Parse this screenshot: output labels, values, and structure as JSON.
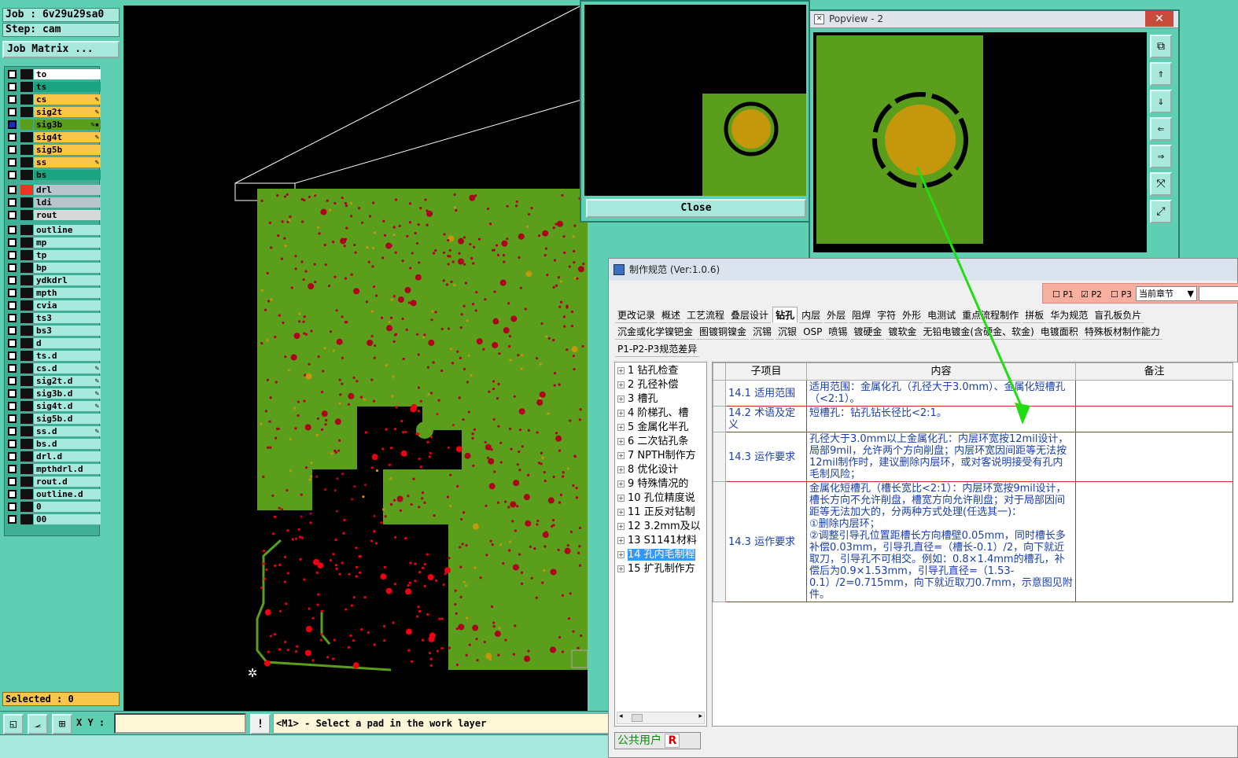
{
  "job_label": "Job : 6v29u29sa0",
  "step_label": "Step: cam",
  "job_matrix": "Job Matrix ...",
  "layers": [
    {
      "name": "to",
      "color": "#ffffff",
      "tag": ""
    },
    {
      "name": "ts",
      "color": "#1aa37f",
      "tag": ""
    },
    {
      "name": "cs",
      "color": "#f7c64a",
      "tag": "✎"
    },
    {
      "name": "sig2t",
      "color": "#f7c64a",
      "tag": "✎"
    },
    {
      "name": "sig3b",
      "color": "#5a9e1c",
      "tag": "✎▪"
    },
    {
      "name": "sig4t",
      "color": "#f7c64a",
      "tag": "✎"
    },
    {
      "name": "sig5b",
      "color": "#f7c64a",
      "tag": ""
    },
    {
      "name": "ss",
      "color": "#f7c64a",
      "tag": "✎"
    },
    {
      "name": "bs",
      "color": "#1aa37f",
      "tag": ""
    },
    {
      "name": "drl",
      "color": "#b8c3cb",
      "tag": ""
    },
    {
      "name": "ldi",
      "color": "#b8c3cb",
      "tag": ""
    },
    {
      "name": "rout",
      "color": "#d8d8d8",
      "tag": ""
    },
    {
      "name": "outline",
      "color": "#a8e8dd",
      "tag": ""
    },
    {
      "name": "mp",
      "color": "#a8e8dd",
      "tag": ""
    },
    {
      "name": "tp",
      "color": "#a8e8dd",
      "tag": ""
    },
    {
      "name": "bp",
      "color": "#a8e8dd",
      "tag": ""
    },
    {
      "name": "ydkdrl",
      "color": "#a8e8dd",
      "tag": ""
    },
    {
      "name": "mpth",
      "color": "#a8e8dd",
      "tag": ""
    },
    {
      "name": "cvia",
      "color": "#a8e8dd",
      "tag": ""
    },
    {
      "name": "ts3",
      "color": "#a8e8dd",
      "tag": ""
    },
    {
      "name": "bs3",
      "color": "#a8e8dd",
      "tag": ""
    },
    {
      "name": "d",
      "color": "#a8e8dd",
      "tag": ""
    },
    {
      "name": "ts.d",
      "color": "#a8e8dd",
      "tag": ""
    },
    {
      "name": "cs.d",
      "color": "#a8e8dd",
      "tag": "✎"
    },
    {
      "name": "sig2t.d",
      "color": "#a8e8dd",
      "tag": "✎"
    },
    {
      "name": "sig3b.d",
      "color": "#a8e8dd",
      "tag": "✎"
    },
    {
      "name": "sig4t.d",
      "color": "#a8e8dd",
      "tag": "✎"
    },
    {
      "name": "sig5b.d",
      "color": "#a8e8dd",
      "tag": ""
    },
    {
      "name": "ss.d",
      "color": "#a8e8dd",
      "tag": "✎"
    },
    {
      "name": "bs.d",
      "color": "#a8e8dd",
      "tag": ""
    },
    {
      "name": "drl.d",
      "color": "#a8e8dd",
      "tag": ""
    },
    {
      "name": "mpthdrl.d",
      "color": "#a8e8dd",
      "tag": ""
    },
    {
      "name": "rout.d",
      "color": "#a8e8dd",
      "tag": ""
    },
    {
      "name": "outline.d",
      "color": "#a8e8dd",
      "tag": ""
    },
    {
      "name": "0",
      "color": "#a8e8dd",
      "tag": ""
    },
    {
      "name": "00",
      "color": "#a8e8dd",
      "tag": ""
    }
  ],
  "selected": "Selected : 0",
  "xy_label": "X Y :",
  "xy_value": "",
  "prompt": "<M1> - Select a pad in the work layer",
  "zoom_close": "Close",
  "popview": {
    "title": "Popview - 2",
    "close": "Close"
  },
  "spec": {
    "title": "制作规范 (Ver:1.0.6)",
    "p1": "P1",
    "p2": "P2",
    "p3": "P3",
    "chapter": "当前章节",
    "tabs1": [
      "更改记录",
      "概述",
      "工艺流程",
      "叠层设计",
      "钻孔",
      "内层",
      "外层",
      "阻焊",
      "字符",
      "外形",
      "电测试",
      "重点流程制作",
      "拼板",
      "华为规范",
      "盲孔板负片"
    ],
    "active_tab": "钻孔",
    "tabs2": [
      "沉金或化学镍钯金",
      "图镀铜镍金",
      "沉锡",
      "沉银",
      "OSP",
      "喷锡",
      "镀硬金",
      "镀软金",
      "无铅电镀金(含硬金、软金)",
      "电镀面积",
      "特殊板材制作能力"
    ],
    "tabs3": [
      "P1-P2-P3规范差异"
    ],
    "tree": [
      "1 钻孔检查",
      "2 孔径补偿",
      "3 槽孔",
      "4 阶梯孔、槽",
      "5 金属化半孔",
      "6 二次钻孔条",
      "7 NPTH制作方",
      "8 优化设计",
      "9 特殊情况的",
      "10 孔位精度说",
      "11 正反对钻制",
      "12 3.2mm及以",
      "13 S1141材料",
      "14 孔内毛制程",
      "15 扩孔制作方"
    ],
    "selected_tree": 13,
    "headers": [
      "子项目",
      "内容",
      "备注"
    ],
    "rows": [
      {
        "sub": "14.1 适用范围",
        "content": "适用范围：金属化孔（孔径大于3.0mm）、金属化短槽孔（<2:1）。",
        "note": ""
      },
      {
        "sub": "14.2 术语及定义",
        "content": "短槽孔：钻孔钻长径比<2:1。",
        "note": ""
      },
      {
        "sub": "14.3 运作要求",
        "content": "孔径大于3.0mm以上金属化孔：内层环宽按12mil设计，局部9mil，允许两个方向削盘；内层环宽因间距等无法按12mil制作时，建议删除内层环，或对客说明接受有孔内毛制风险；",
        "note": ""
      },
      {
        "sub": "14.3 运作要求",
        "content": "金属化短槽孔（槽长宽比<2:1）：内层环宽按9mil设计，槽长方向不允许削盘，槽宽方向允许削盘；对于局部因间距等无法加大的，分两种方式处理(任选其一)：\n①删除内层环；\n②调整引导孔位置距槽长方向槽壁0.05mm，同时槽长多补偿0.03mm，引导孔直径=（槽长-0.1）/2，向下就近取刀，引导孔不可相交。例如：0.8×1.4mm的槽孔，补偿后为0.9×1.53mm，引导孔直径=（1.53-0.1）/2=0.715mm，向下就近取刀0.7mm，示意图见附件。",
        "note": ""
      }
    ],
    "user": "公共用户",
    "user_badge": "R"
  }
}
